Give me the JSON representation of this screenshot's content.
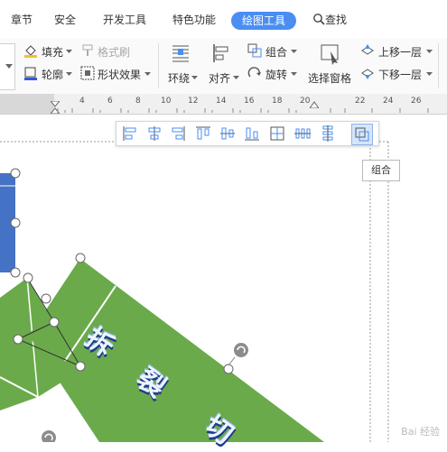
{
  "tabs": [
    "章节",
    "安全",
    "开发工具",
    "特色功能",
    "绘图工具",
    "查找"
  ],
  "ribbon": {
    "fill": "填充",
    "format_brush": "格式刷",
    "outline": "轮廓",
    "shape_effects": "形状效果",
    "wrap": "环绕",
    "align": "对齐",
    "group": "组合",
    "rotate": "旋转",
    "selection_pane": "选择窗格",
    "bring_forward": "上移一层",
    "send_backward": "下移一层"
  },
  "ruler_labels": [
    "4",
    "6",
    "8",
    "10",
    "12",
    "14",
    "16",
    "18",
    "20",
    "22",
    "24",
    "26"
  ],
  "tooltip": "组合",
  "canvas_text": [
    "拆",
    "裂",
    "切"
  ],
  "watermark": "Bai 经验",
  "colors": {
    "accent": "#4a8ef1",
    "shape_green": "#6aaa4b",
    "shape_blue": "#4472c4"
  }
}
